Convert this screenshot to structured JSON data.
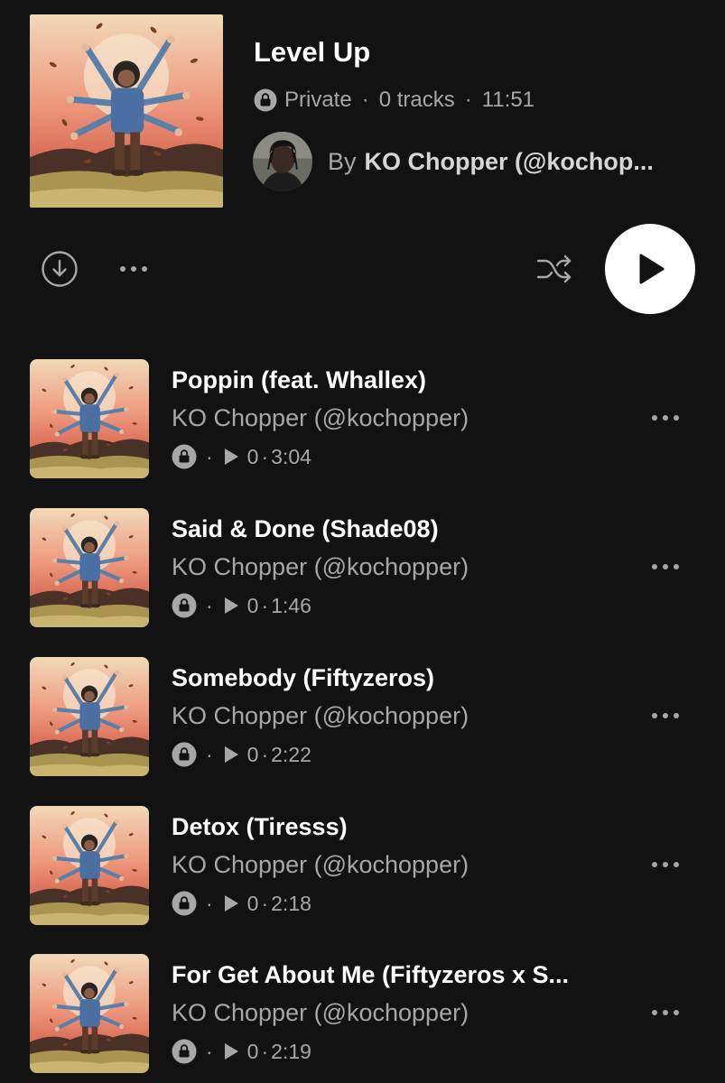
{
  "playlist": {
    "title": "Level Up",
    "visibility": "Private",
    "track_count": "0 tracks",
    "duration": "11:51",
    "by_label": "By",
    "owner": "KO Chopper (@kochop..."
  },
  "meta_separator": "·",
  "controls": {
    "download_icon": "download-circle-icon",
    "more_icon": "more-horizontal-icon",
    "shuffle_icon": "shuffle-icon",
    "play_icon": "play-icon"
  },
  "tracks": [
    {
      "title": "Poppin (feat. Whallex)",
      "artist": "KO Chopper (@kochopper)",
      "plays": "0",
      "duration": "3:04"
    },
    {
      "title": "Said & Done (Shade08)",
      "artist": "KO Chopper (@kochopper)",
      "plays": "0",
      "duration": "1:46"
    },
    {
      "title": "Somebody (Fiftyzeros)",
      "artist": "KO Chopper (@kochopper)",
      "plays": "0",
      "duration": "2:22"
    },
    {
      "title": "Detox (Tiresss)",
      "artist": "KO Chopper (@kochopper)",
      "plays": "0",
      "duration": "2:18"
    },
    {
      "title": "For Get About Me (Fiftyzeros x S...",
      "artist": "KO Chopper (@kochopper)",
      "plays": "0",
      "duration": "2:19"
    }
  ],
  "colors": {
    "background": "#121212",
    "primary_text": "#ffffff",
    "secondary_text": "#a7a7a7",
    "play_button": "#ffffff"
  }
}
